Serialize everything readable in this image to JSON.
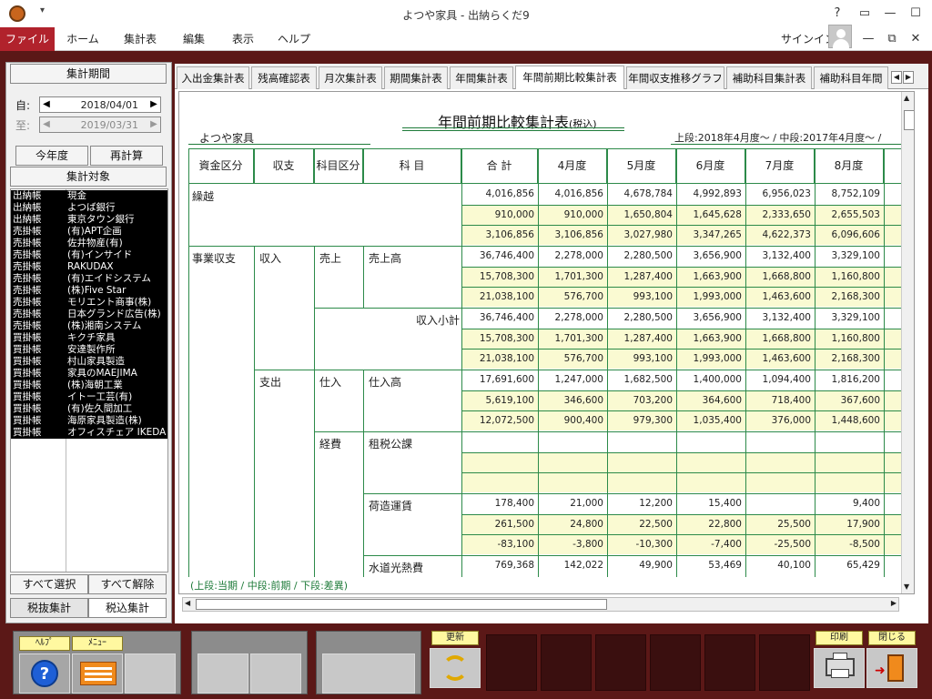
{
  "window": {
    "title": "よつや家具 - 出納らくだ9",
    "help": "?"
  },
  "menu": {
    "file": "ファイル",
    "home": "ホーム",
    "summary": "集計表",
    "edit": "編集",
    "view": "表示",
    "help": "ヘルプ",
    "signin": "サインイン"
  },
  "left": {
    "period_button": "集計期間",
    "from_label": "自:",
    "from_date": "2018/04/01",
    "to_label": "至:",
    "to_date": "2019/03/31",
    "this_year": "今年度",
    "recalc": "再計算",
    "target_button": "集計対象",
    "accounts": [
      [
        "出納帳",
        "現金"
      ],
      [
        "出納帳",
        "よつば銀行"
      ],
      [
        "出納帳",
        "東京タウン銀行"
      ],
      [
        "売掛帳",
        "(有)APT企画"
      ],
      [
        "売掛帳",
        "佐井物産(有)"
      ],
      [
        "売掛帳",
        "(有)インサイド"
      ],
      [
        "売掛帳",
        "RAKUDAX"
      ],
      [
        "売掛帳",
        "(有)エイドシステム"
      ],
      [
        "売掛帳",
        "(株)Five Star"
      ],
      [
        "売掛帳",
        "モリエント商事(株)"
      ],
      [
        "売掛帳",
        "日本グランド広告(株)"
      ],
      [
        "売掛帳",
        "(株)湘南システム"
      ],
      [
        "買掛帳",
        "キクチ家具"
      ],
      [
        "買掛帳",
        "安達製作所"
      ],
      [
        "買掛帳",
        "村山家具製造"
      ],
      [
        "買掛帳",
        "家具のMAEJIMA"
      ],
      [
        "買掛帳",
        "(株)海朝工業"
      ],
      [
        "買掛帳",
        "イトー工芸(有)"
      ],
      [
        "買掛帳",
        "(有)佐久間加工"
      ],
      [
        "買掛帳",
        "海原家具製造(株)"
      ],
      [
        "買掛帳",
        "オフィスチェア IKEDA"
      ]
    ],
    "select_all": "すべて選択",
    "deselect_all": "すべて解除",
    "tax_excluded": "税抜集計",
    "tax_included": "税込集計"
  },
  "tabs": [
    "入出金集計表",
    "残高確認表",
    "月次集計表",
    "期間集計表",
    "年間集計表",
    "年間前期比較集計表",
    "年間収支推移グラフ",
    "補助科目集計表",
    "補助科目年間"
  ],
  "report": {
    "title": "年間前期比較集計表",
    "title_sub": "(税込)",
    "company": "よつや家具",
    "period": "上段:2018年4月度～ / 中段:2017年4月度～ /",
    "headers": [
      "資金区分",
      "収支",
      "科目区分",
      "科 目",
      "合 計",
      "4月度",
      "5月度",
      "6月度",
      "7月度",
      "8月度"
    ],
    "labels": {
      "kurikoshi": "繰越",
      "jigyo": "事業収支",
      "shunyu": "収入",
      "uriage": "売上",
      "uriagedaka": "売上高",
      "shunyu_shokei": "収入小計",
      "shishutsu": "支出",
      "shiire": "仕入",
      "shiiredaka": "仕入高",
      "keihi": "経費",
      "sozei": "租税公課",
      "nizukuri": "荷造運賃",
      "suido": "水道光熱費"
    },
    "rows": {
      "kurikoshi": [
        [
          "4,016,856",
          "4,016,856",
          "4,678,784",
          "4,992,893",
          "6,956,023",
          "8,752,109"
        ],
        [
          "910,000",
          "910,000",
          "1,650,804",
          "1,645,628",
          "2,333,650",
          "2,655,503"
        ],
        [
          "3,106,856",
          "3,106,856",
          "3,027,980",
          "3,347,265",
          "4,622,373",
          "6,096,606"
        ]
      ],
      "uriagedaka": [
        [
          "36,746,400",
          "2,278,000",
          "2,280,500",
          "3,656,900",
          "3,132,400",
          "3,329,100"
        ],
        [
          "15,708,300",
          "1,701,300",
          "1,287,400",
          "1,663,900",
          "1,668,800",
          "1,160,800"
        ],
        [
          "21,038,100",
          "576,700",
          "993,100",
          "1,993,000",
          "1,463,600",
          "2,168,300"
        ]
      ],
      "shunyu_shokei": [
        [
          "36,746,400",
          "2,278,000",
          "2,280,500",
          "3,656,900",
          "3,132,400",
          "3,329,100"
        ],
        [
          "15,708,300",
          "1,701,300",
          "1,287,400",
          "1,663,900",
          "1,668,800",
          "1,160,800"
        ],
        [
          "21,038,100",
          "576,700",
          "993,100",
          "1,993,000",
          "1,463,600",
          "2,168,300"
        ]
      ],
      "shiiredaka": [
        [
          "17,691,600",
          "1,247,000",
          "1,682,500",
          "1,400,000",
          "1,094,400",
          "1,816,200"
        ],
        [
          "5,619,100",
          "346,600",
          "703,200",
          "364,600",
          "718,400",
          "367,600"
        ],
        [
          "12,072,500",
          "900,400",
          "979,300",
          "1,035,400",
          "376,000",
          "1,448,600"
        ]
      ],
      "sozei": [
        [
          "",
          "",
          "",
          "",
          "",
          ""
        ],
        [
          "",
          "",
          "",
          "",
          "",
          ""
        ],
        [
          "",
          "",
          "",
          "",
          "",
          ""
        ]
      ],
      "nizukuri": [
        [
          "178,400",
          "21,000",
          "12,200",
          "15,400",
          "",
          "9,400"
        ],
        [
          "261,500",
          "24,800",
          "22,500",
          "22,800",
          "25,500",
          "17,900"
        ],
        [
          "-83,100",
          "-3,800",
          "-10,300",
          "-7,400",
          "-25,500",
          "-8,500"
        ]
      ],
      "suido": [
        [
          "769,368",
          "142,022",
          "49,900",
          "53,469",
          "40,100",
          "65,429"
        ]
      ]
    },
    "footer": "(上段:当期 / 中段:前期 / 下段:差異)"
  },
  "toolbar": {
    "help": "ﾍﾙﾌﾟ",
    "menu": "ﾒﾆｭｰ",
    "refresh": "更新",
    "print": "印刷",
    "close": "閉じる"
  },
  "colors": {
    "accent": "#b1222c",
    "frame": "#5b1817",
    "highlight_row": "#fafad2",
    "grid_line": "#2c8a49"
  }
}
